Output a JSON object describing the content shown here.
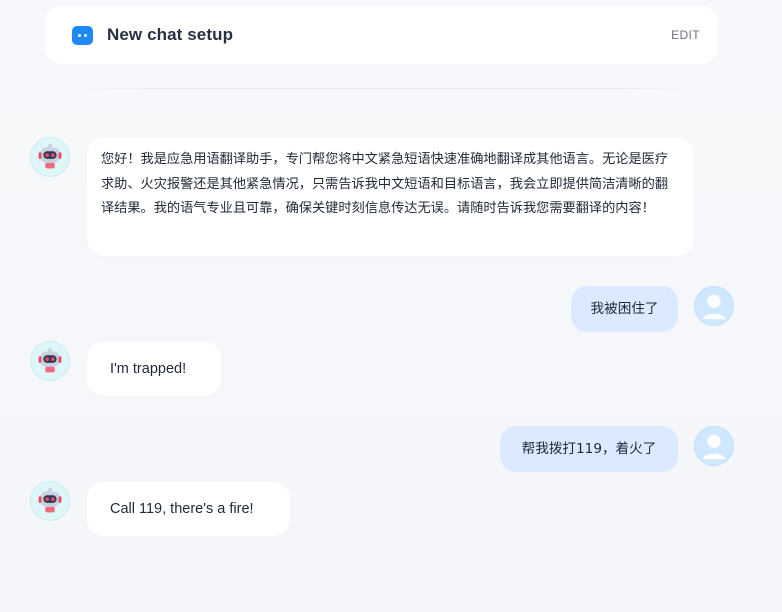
{
  "header": {
    "title": "New chat setup",
    "edit_label": "EDIT",
    "icon": "chat-bot-icon",
    "accent_color": "#1e88f5"
  },
  "messages": [
    {
      "role": "assistant",
      "avatar": "robot-avatar-icon",
      "text": "您好！我是应急用语翻译助手，专门帮您将中文紧急短语快速准确地翻译成其他语言。无论是医疗求助、火灾报警还是其他紧急情况，只需告诉我中文短语和目标语言，我会立即提供简洁清晰的翻译结果。我的语气专业且可靠，确保关键时刻信息传达无误。请随时告诉我您需要翻译的内容！"
    },
    {
      "role": "user",
      "avatar": "user-avatar-icon",
      "text": "我被困住了"
    },
    {
      "role": "assistant",
      "avatar": "robot-avatar-icon",
      "text": "I'm trapped!"
    },
    {
      "role": "user",
      "avatar": "user-avatar-icon",
      "text": "帮我拨打119，着火了"
    },
    {
      "role": "assistant",
      "avatar": "robot-avatar-icon",
      "text": "Call 119, there's a fire!"
    }
  ],
  "colors": {
    "bot_bubble": "#ffffff",
    "user_bubble": "#dbeafe",
    "page_background": "#f5f7fa"
  }
}
